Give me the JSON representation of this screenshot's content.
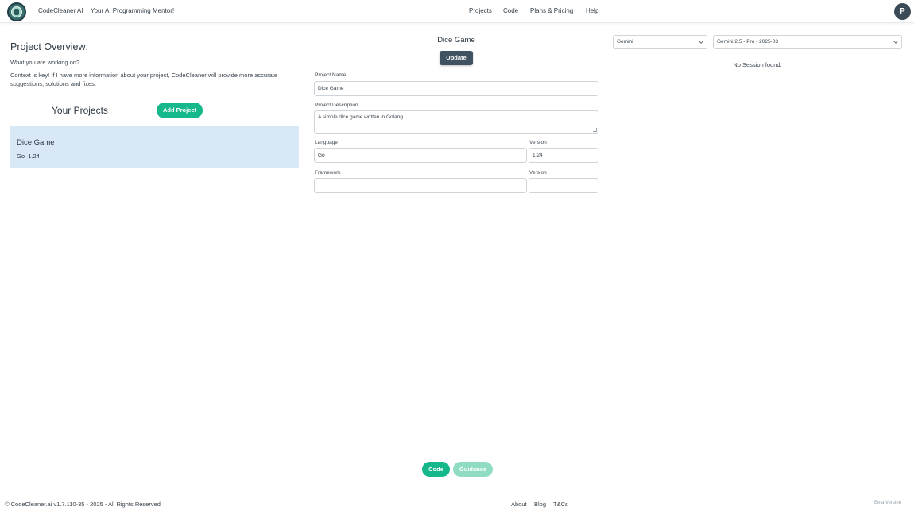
{
  "navbar": {
    "brand": "CodeCleaner AI",
    "tagline": "Your AI Programming Mentor!",
    "links": [
      "Projects",
      "Code",
      "Plans & Pricing",
      "Help"
    ],
    "avatar_initial": "P"
  },
  "overview": {
    "title": "Project Overview:",
    "subtitle": "What you are working on?",
    "context": "Context is key! If I have more information about your project, CodeCleaner will provide more accurate suggestions, solutions and fixes.",
    "projects_heading": "Your Projects",
    "add_project_label": "Add Project"
  },
  "projects": [
    {
      "name": "Dice Game",
      "language": "Go",
      "version": "1.24"
    }
  ],
  "form": {
    "title": "Dice Game",
    "update_label": "Update",
    "project_name_label": "Project Name",
    "project_name_value": "Dice Game",
    "description_label": "Project Description",
    "description_value": "A simple dice game written in Golang.",
    "language_label": "Language",
    "language_value": "Go",
    "version_label": "Version",
    "version_value": "1.24",
    "framework_label": "Framework",
    "framework_value": "",
    "framework_version_label": "Version",
    "framework_version_value": ""
  },
  "session": {
    "provider": "Gemini",
    "model": "Gemini 2.5 - Pro - 2025-03",
    "empty_text": "No Session found."
  },
  "mode_buttons": {
    "code": "Code",
    "guidance": "Guidance"
  },
  "footer": {
    "copyright": "© CodeCleaner.ai v1.7.110-35 - 2025 - All Rights Reserved",
    "links": [
      "About",
      "Blog",
      "T&Cs"
    ],
    "beta": "Beta Version"
  },
  "colors": {
    "accent_green": "#14b88a",
    "accent_green_disabled": "#8fdcc3",
    "dark_slate": "#3e5261",
    "card_selected": "#d9e8f6"
  }
}
